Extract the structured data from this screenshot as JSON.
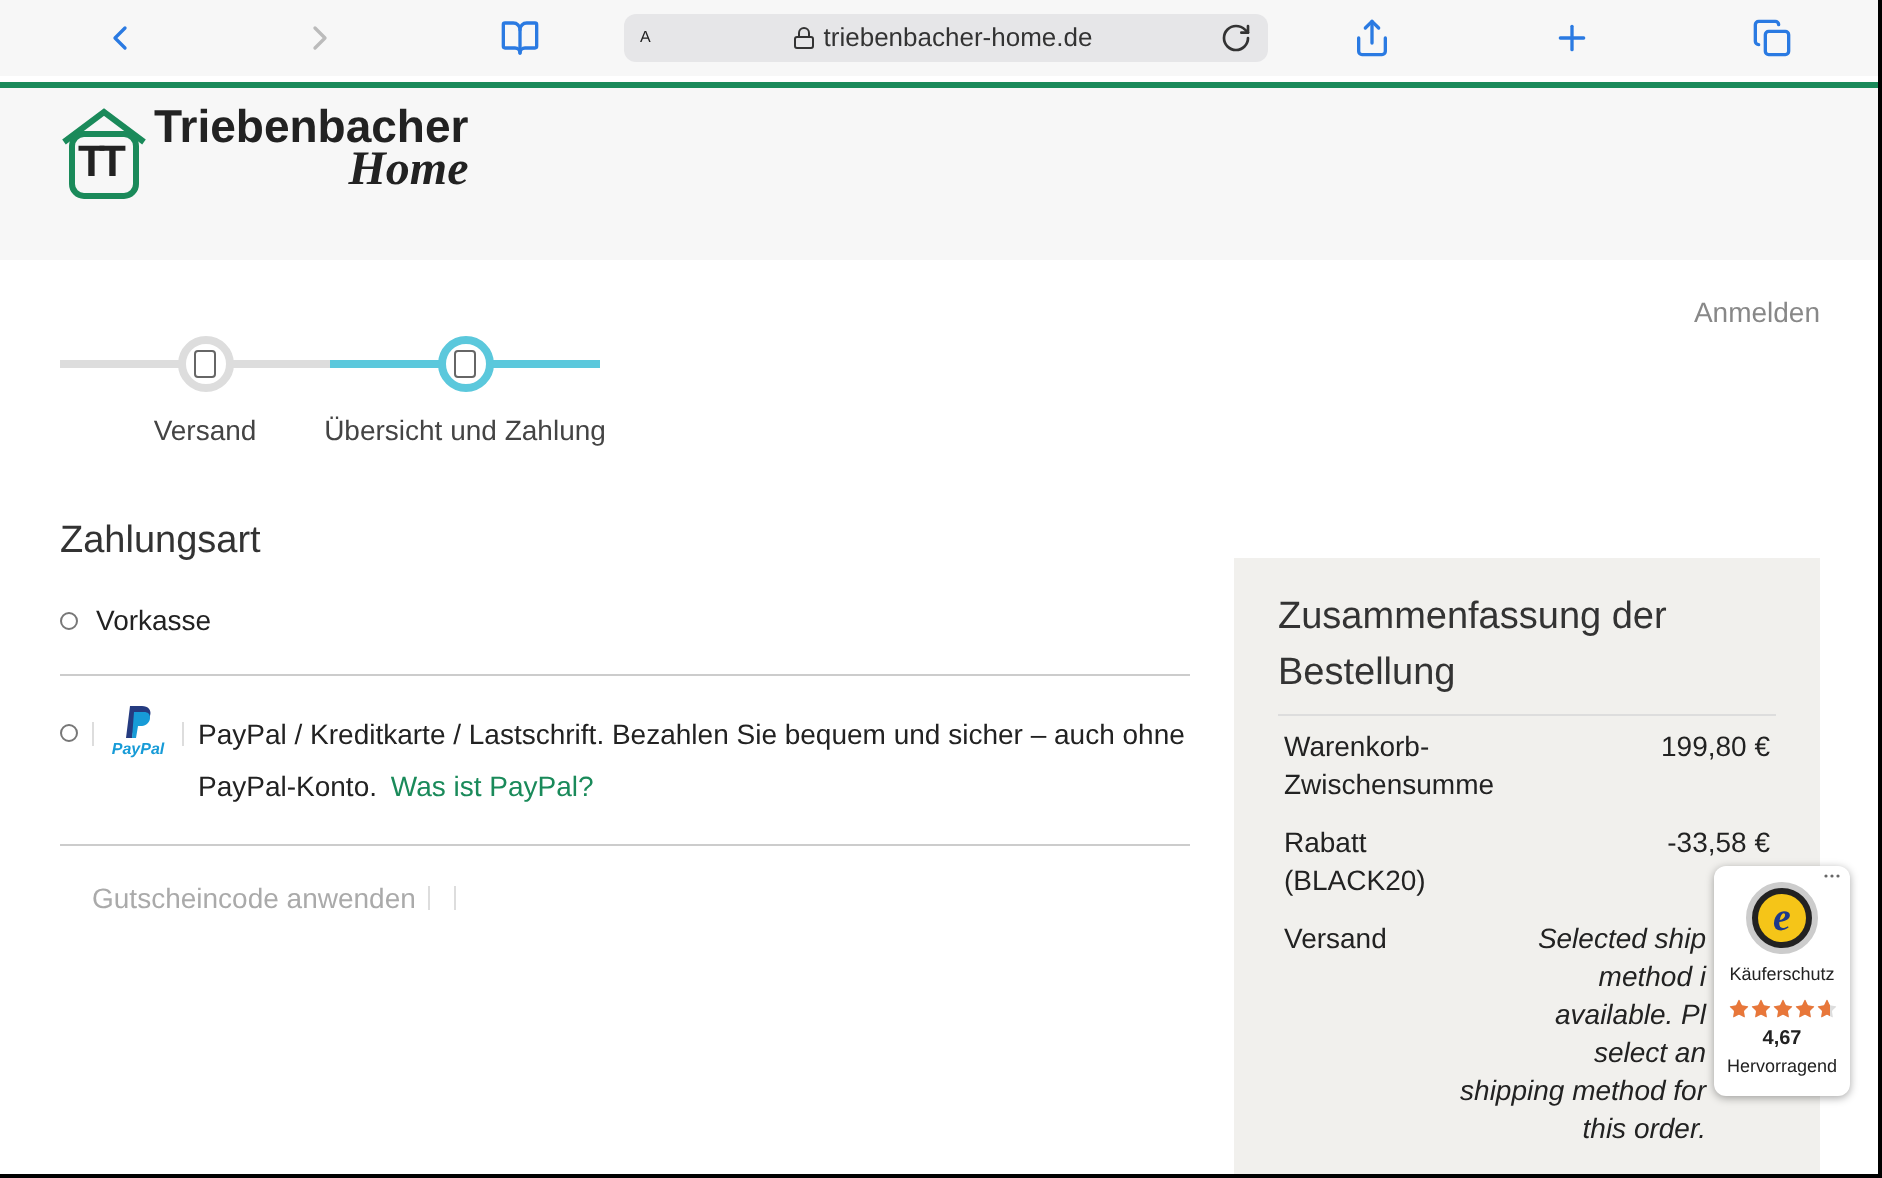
{
  "browser": {
    "url": "triebenbacher-home.de",
    "text_size": "A"
  },
  "logo": {
    "mark": "TT",
    "name": "Triebenbacher",
    "sub": "Home"
  },
  "login": "Anmelden",
  "steps": [
    {
      "label": "Versand",
      "selected": false
    },
    {
      "label": "Übersicht und Zahlung",
      "selected": true
    }
  ],
  "payment": {
    "title": "Zahlungsart",
    "options": [
      {
        "kind": "plain",
        "label": "Vorkasse",
        "selected": false
      },
      {
        "kind": "paypal",
        "logo_text": "PayPal",
        "label": "PayPal / Kreditkarte / Lastschrift. Bezahlen Sie bequem und sicher – auch ohne PayPal-Konto.",
        "link": "Was ist PayPal?",
        "selected": false
      }
    ],
    "coupon": "Gutscheincode anwenden"
  },
  "summary": {
    "title": "Zusammenfassung der Bestellung",
    "rows": [
      {
        "label": "Warenkorb-Zwischensumme",
        "value": "199,80 €"
      },
      {
        "label": "Rabatt (BLACK20)",
        "value": "-33,58 €"
      },
      {
        "label": "Versand",
        "value_lines": [
          "Selected ship",
          "method i",
          "available. Pl",
          "select an",
          "shipping method for",
          "this order."
        ]
      }
    ]
  },
  "badge": {
    "seal": "e",
    "label": "Käuferschutz",
    "stars": 4.67,
    "rating": "4,67",
    "verdict": "Hervorragend"
  }
}
